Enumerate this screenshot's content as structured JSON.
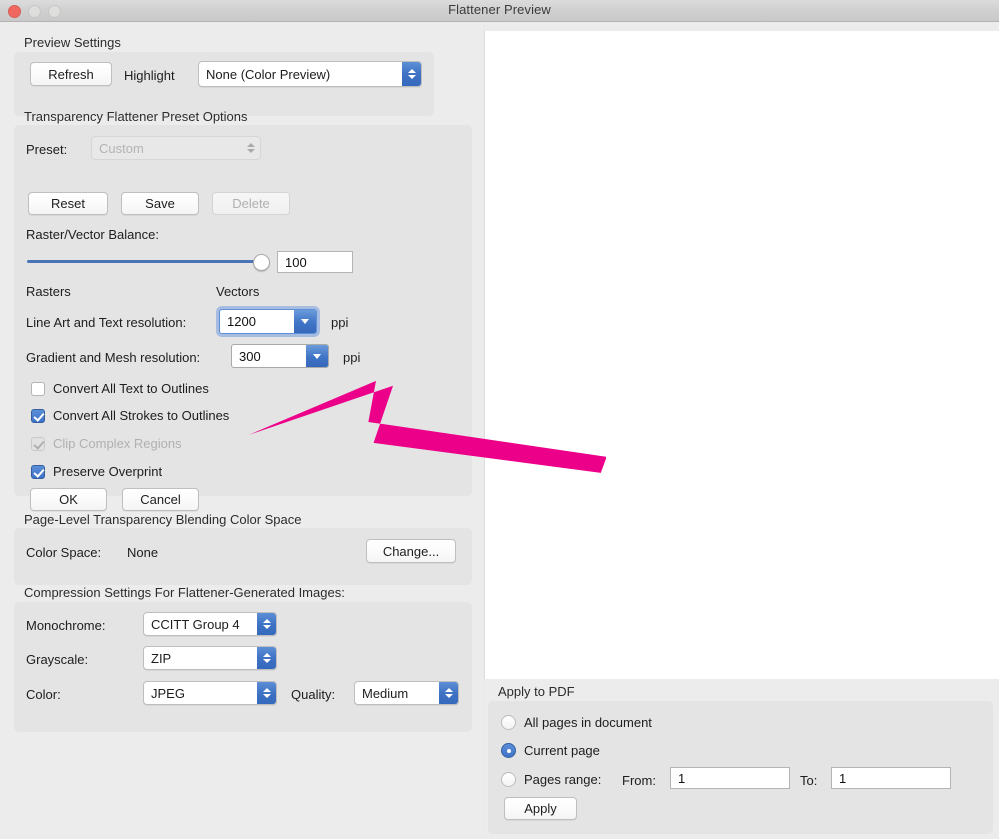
{
  "window": {
    "title": "Flattener Preview",
    "controls": {
      "close": "close-button",
      "minimize": "minimize-button",
      "maximize": "maximize-button"
    }
  },
  "preview_settings": {
    "group_label": "Preview Settings",
    "refresh_label": "Refresh",
    "highlight_label": "Highlight",
    "highlight_value": "None (Color Preview)"
  },
  "preset_options": {
    "group_label": "Transparency Flattener Preset Options",
    "preset_label": "Preset:",
    "preset_value": "Custom",
    "reset_label": "Reset",
    "save_label": "Save",
    "delete_label": "Delete",
    "balance_label": "Raster/Vector Balance:",
    "balance_value": "100",
    "balance_min": 0,
    "balance_max": 100,
    "rasters_label": "Rasters",
    "vectors_label": "Vectors",
    "line_art_label": "Line Art and Text resolution:",
    "line_art_value": "1200",
    "line_art_unit": "ppi",
    "gradient_label": "Gradient and Mesh resolution:",
    "gradient_value": "300",
    "gradient_unit": "ppi",
    "checkboxes": [
      {
        "label": "Convert All Text to Outlines",
        "checked": false,
        "enabled": true
      },
      {
        "label": "Convert All Strokes to Outlines",
        "checked": true,
        "enabled": true
      },
      {
        "label": "Clip Complex Regions",
        "checked": true,
        "enabled": false
      },
      {
        "label": "Preserve Overprint",
        "checked": true,
        "enabled": true
      }
    ],
    "ok_label": "OK",
    "cancel_label": "Cancel"
  },
  "color_space": {
    "group_label": "Page-Level Transparency Blending Color Space",
    "field_label": "Color Space:",
    "value": "None",
    "change_label": "Change..."
  },
  "compression": {
    "group_label": "Compression Settings For Flattener-Generated Images:",
    "monochrome_label": "Monochrome:",
    "monochrome_value": "CCITT Group 4",
    "grayscale_label": "Grayscale:",
    "grayscale_value": "ZIP",
    "color_label": "Color:",
    "color_value": "JPEG",
    "quality_label": "Quality:",
    "quality_value": "Medium"
  },
  "apply_to_pdf": {
    "group_label": "Apply to PDF",
    "options": [
      {
        "label": "All pages in document",
        "selected": false
      },
      {
        "label": "Current page",
        "selected": true
      },
      {
        "label": "Pages range:",
        "selected": false
      }
    ],
    "from_label": "From:",
    "from_value": "1",
    "to_label": "To:",
    "to_value": "1",
    "apply_label": "Apply"
  },
  "annotation": {
    "arrow_color": "#EC0089",
    "arrow_points_to": "Convert All Strokes to Outlines"
  },
  "colors": {
    "window_bg": "#ECECEC",
    "group_bg": "#E4E4E4",
    "accent_blue": "#3F72C6",
    "annotation_pink": "#EC0089",
    "preview_bg": "#FFFFFF"
  }
}
